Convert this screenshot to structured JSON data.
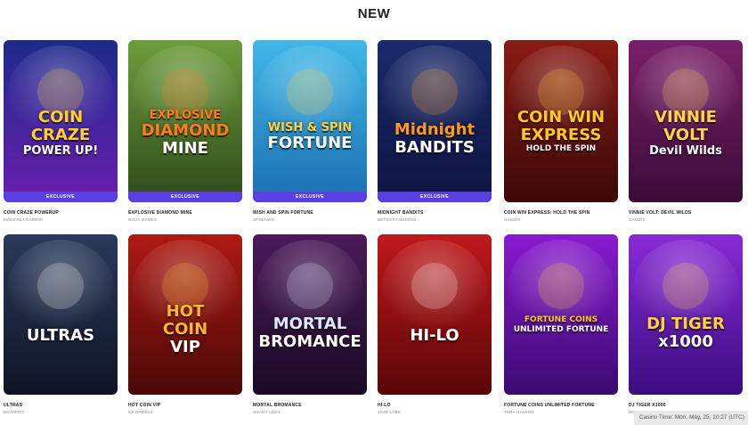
{
  "section": {
    "title": "NEW"
  },
  "badge_label": "EXCLUSIVE",
  "games": [
    {
      "name": "COIN CRAZE POWERUP",
      "provider": "MANCALA GAMING",
      "exclusive": true,
      "logo_lines": [
        "COIN",
        "CRAZE",
        "POWER UP!"
      ],
      "bg": [
        "#1c2a8a",
        "#6a1fb0"
      ],
      "accent": "#ffcf2e"
    },
    {
      "name": "EXPLOSIVE DIAMOND MINE",
      "provider": "NOVA GAMES",
      "exclusive": true,
      "logo_lines": [
        "EXPLOSIVE",
        "DIAMOND",
        "MINE"
      ],
      "bg": [
        "#6d9e3a",
        "#2e4a1a"
      ],
      "accent": "#ff7a1a"
    },
    {
      "name": "WISH AND SPIN FORTUNE",
      "provider": "SPINAWIN",
      "exclusive": true,
      "logo_lines": [
        "WISH & SPIN",
        "FORTUNE"
      ],
      "bg": [
        "#3fb8e8",
        "#1c6fb0"
      ],
      "accent": "#ffd23a"
    },
    {
      "name": "MIDNIGHT BANDITS",
      "provider": "BETSOFT GAMING",
      "exclusive": true,
      "logo_lines": [
        "Midnight",
        "BANDITS"
      ],
      "bg": [
        "#1a2a6a",
        "#0e1440"
      ],
      "accent": "#ff9a1f"
    },
    {
      "name": "COIN WIN EXPRESS: HOLD THE SPIN",
      "provider": "GAMZIX",
      "exclusive": false,
      "logo_lines": [
        "COIN WIN",
        "EXPRESS",
        "HOLD THE SPIN"
      ],
      "bg": [
        "#8a1a14",
        "#3a0a08"
      ],
      "accent": "#ffc629"
    },
    {
      "name": "VINNIE VOLT: DEVIL WILDS",
      "provider": "GAMZIX",
      "exclusive": false,
      "logo_lines": [
        "VINNIE",
        "VOLT",
        "Devil Wilds"
      ],
      "bg": [
        "#7a1f6a",
        "#3a0c36"
      ],
      "accent": "#ffd34a"
    },
    {
      "name": "ULTRAS",
      "provider": "BGAMING",
      "exclusive": false,
      "logo_lines": [
        "ULTRAS"
      ],
      "bg": [
        "#2a3a5a",
        "#0e1424"
      ],
      "accent": "#ffffff"
    },
    {
      "name": "HOT COIN VIP",
      "provider": "KA GAMING",
      "exclusive": false,
      "logo_lines": [
        "HOT",
        "COIN",
        "VIP"
      ],
      "bg": [
        "#b01a12",
        "#4a0806"
      ],
      "accent": "#ffb52a"
    },
    {
      "name": "MORTAL BROMANCE",
      "provider": "SHADY LADY",
      "exclusive": false,
      "logo_lines": [
        "MORTAL",
        "BROMANCE"
      ],
      "bg": [
        "#4a1a5a",
        "#1a0a24"
      ],
      "accent": "#e0e6ff"
    },
    {
      "name": "HI-LO",
      "provider": "1X2B LABS",
      "exclusive": false,
      "logo_lines": [
        "HI-LO"
      ],
      "bg": [
        "#c0181a",
        "#5a0608"
      ],
      "accent": "#ffffff"
    },
    {
      "name": "FORTUNE COINS UNLIMITED FORTUNE",
      "provider": "TADA GAMING",
      "exclusive": false,
      "logo_lines": [
        "FORTUNE COINS",
        "UNLIMITED FORTUNE"
      ],
      "bg": [
        "#8a1ad0",
        "#3a0a70"
      ],
      "accent": "#ffc629"
    },
    {
      "name": "DJ TIGER X1000",
      "provider": "BGAMING",
      "exclusive": false,
      "logo_lines": [
        "DJ TIGER",
        "x1000"
      ],
      "bg": [
        "#8a2ad8",
        "#3a0c80"
      ],
      "accent": "#ffd23a"
    }
  ],
  "footer": {
    "casino_time": "Casino Time: Mon, May, 25, 10:27 (UTC)"
  }
}
